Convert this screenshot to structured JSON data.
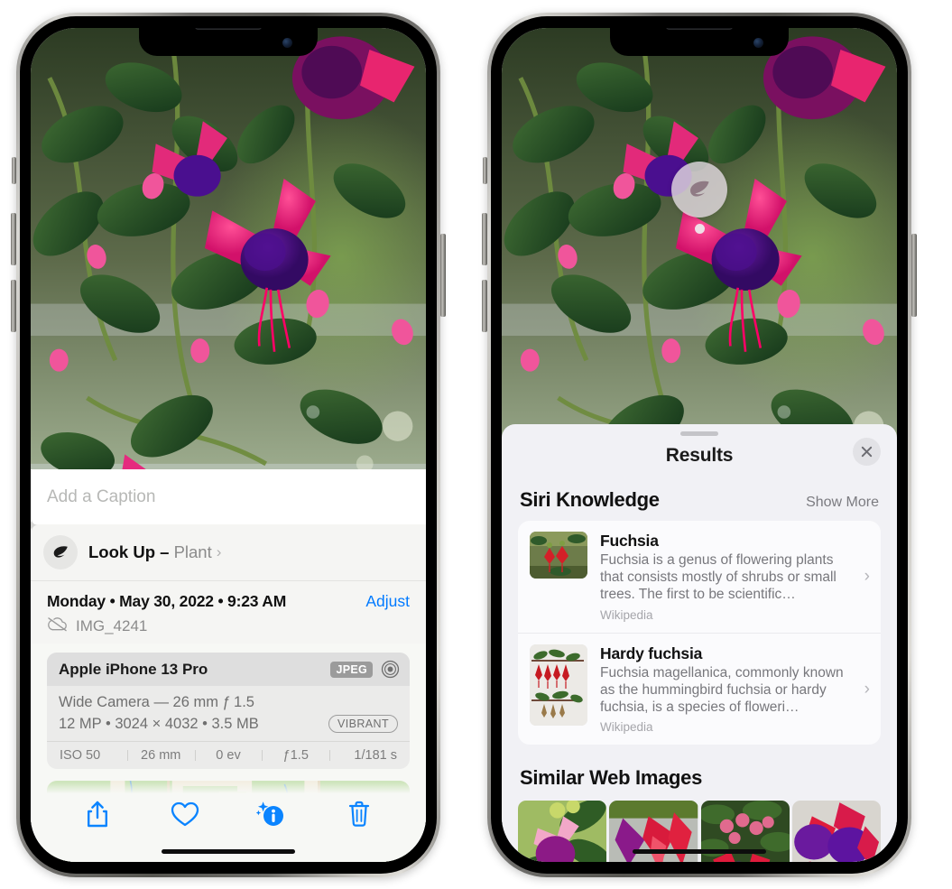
{
  "left_phone": {
    "caption_placeholder": "Add a Caption",
    "lookup": {
      "label": "Look Up –",
      "subject": "Plant",
      "chevron": "›",
      "icon": "leaf-icon"
    },
    "meta": {
      "date": "Monday • May 30, 2022 • 9:23 AM",
      "adjust_label": "Adjust",
      "filename": "IMG_4241",
      "cloud_icon": "icloud-slash-icon"
    },
    "exif": {
      "device": "Apple iPhone 13 Pro",
      "format_badge": "JPEG",
      "raw_icon": "aperture-icon",
      "lens": "Wide Camera — 26 mm ƒ 1.5",
      "dimensions": "12 MP • 3024 × 4032 • 3.5 MB",
      "style_badge": "VIBRANT",
      "stats": [
        "ISO 50",
        "26 mm",
        "0 ev",
        "ƒ1.5",
        "1/181 s"
      ]
    },
    "toolbar": [
      {
        "name": "share-button",
        "icon": "share-icon"
      },
      {
        "name": "favorite-button",
        "icon": "heart-icon"
      },
      {
        "name": "info-button",
        "icon": "info-sparkle-icon"
      },
      {
        "name": "delete-button",
        "icon": "trash-icon"
      }
    ],
    "accent_color": "#007aff"
  },
  "right_phone": {
    "bubble_icon": "leaf-icon",
    "sheet": {
      "title": "Results",
      "close_icon": "close-icon",
      "sections": [
        {
          "title": "Siri Knowledge",
          "action": "Show More",
          "items": [
            {
              "title": "Fuchsia",
              "description": "Fuchsia is a genus of flowering plants that consists mostly of shrubs or small trees. The first to be scientific…",
              "source": "Wikipedia",
              "thumb": "fuchsia-red-thumb"
            },
            {
              "title": "Hardy fuchsia",
              "description": "Fuchsia magellanica, commonly known as the hummingbird fuchsia or hardy fuchsia, is a species of floweri…",
              "source": "Wikipedia",
              "thumb": "hardy-fuchsia-thumb"
            }
          ]
        },
        {
          "title": "Similar Web Images",
          "action": "",
          "thumbs": [
            "sim-image-1",
            "sim-image-2",
            "sim-image-3",
            "sim-image-4"
          ]
        }
      ]
    }
  }
}
